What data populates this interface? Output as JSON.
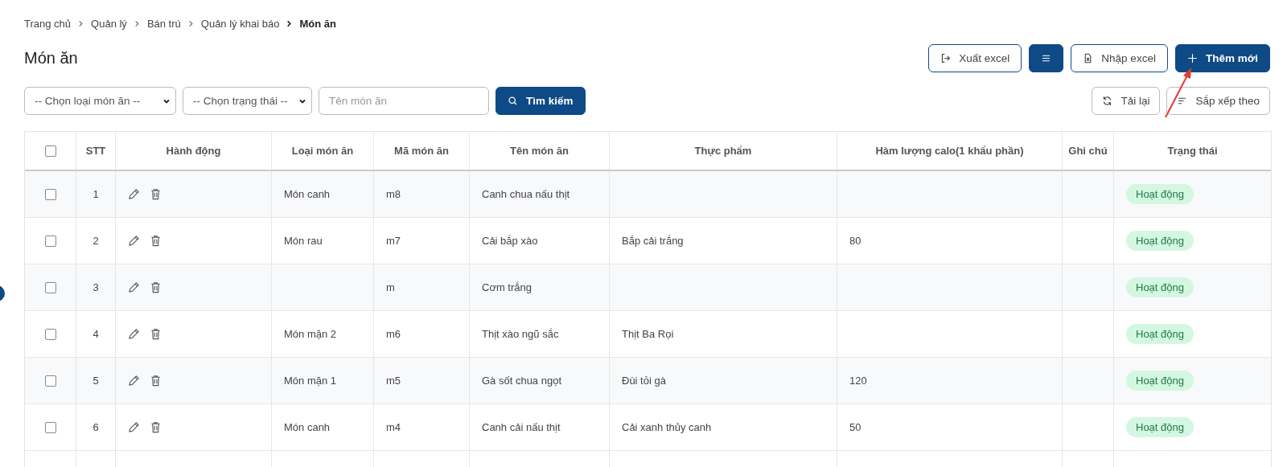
{
  "breadcrumb": [
    {
      "label": "Trang chủ",
      "current": false
    },
    {
      "label": "Quản lý",
      "current": false
    },
    {
      "label": "Bán trú",
      "current": false
    },
    {
      "label": "Quản lý khai báo",
      "current": false
    },
    {
      "label": "Món ăn",
      "current": true
    }
  ],
  "page_title": "Món ăn",
  "header_buttons": [
    {
      "kind": "outline",
      "label": "Xuất excel"
    },
    {
      "kind": "solid"
    },
    {
      "kind": "outline",
      "label": "Nhập excel"
    },
    {
      "kind": "solid",
      "label": "Thêm mới"
    }
  ],
  "filters": {
    "dish_type": {
      "value": "-- Chọn loại món ăn --"
    },
    "status": {
      "value": "-- Chọn trạng thái --"
    },
    "search": {
      "placeholder": "Tên món ăn"
    },
    "search_button": "Tìm kiếm"
  },
  "tools": [
    {
      "label": "Tải lại"
    },
    {
      "label": "Sắp xếp theo"
    }
  ],
  "table": {
    "select_all": {
      "checked": false
    },
    "columns": [
      "STT",
      "Hành động",
      "Loại món ăn",
      "Mã món ăn",
      "Tên món ăn",
      "Thực phẩm",
      "Hàm lượng calo(1 khẩu phần)",
      "Ghi chú",
      "Trạng thái"
    ],
    "rows": [
      {
        "checked": false,
        "stt": "1",
        "type": "Món canh",
        "code": "m8",
        "name": "Canh chua nấu thịt",
        "status": "Hoạt động"
      },
      {
        "checked": false,
        "stt": "2",
        "type": "Món rau",
        "code": "m7",
        "name": "Cải bắp xào",
        "ingredients": "Bắp cải trắng",
        "calories": "80",
        "status": "Hoạt động"
      },
      {
        "checked": false,
        "stt": "3",
        "code": "m",
        "name": "Cơm trắng",
        "status": "Hoạt động"
      },
      {
        "checked": false,
        "stt": "4",
        "type": "Món mặn 2",
        "code": "m6",
        "name": "Thịt xào ngũ sắc",
        "ingredients": "Thịt Ba Rọi",
        "status": "Hoạt động"
      },
      {
        "checked": false,
        "stt": "5",
        "type": "Món mặn 1",
        "code": "m5",
        "name": "Gà sốt chua ngọt",
        "ingredients": "Đùi tỏi gà",
        "calories": "120",
        "status": "Hoạt động"
      },
      {
        "checked": false,
        "stt": "6",
        "type": "Món canh",
        "code": "m4",
        "name": "Canh cải nấu thịt",
        "ingredients": "Cải xanh thủy canh",
        "calories": "50",
        "status": "Hoạt động"
      }
    ]
  }
}
